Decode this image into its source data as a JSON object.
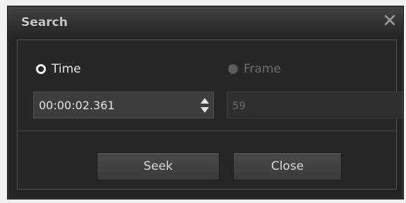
{
  "dialog": {
    "title": "Search",
    "close_icon": "close-icon"
  },
  "mode": {
    "time_label": "Time",
    "time_selected": true,
    "frame_label": "Frame",
    "frame_enabled": false
  },
  "time_input": {
    "value": "00:00:02.361",
    "arrows_icon": "up-down-spinner-icon"
  },
  "frame_input": {
    "value": "59"
  },
  "buttons": {
    "seek_label": "Seek",
    "close_label": "Close"
  }
}
